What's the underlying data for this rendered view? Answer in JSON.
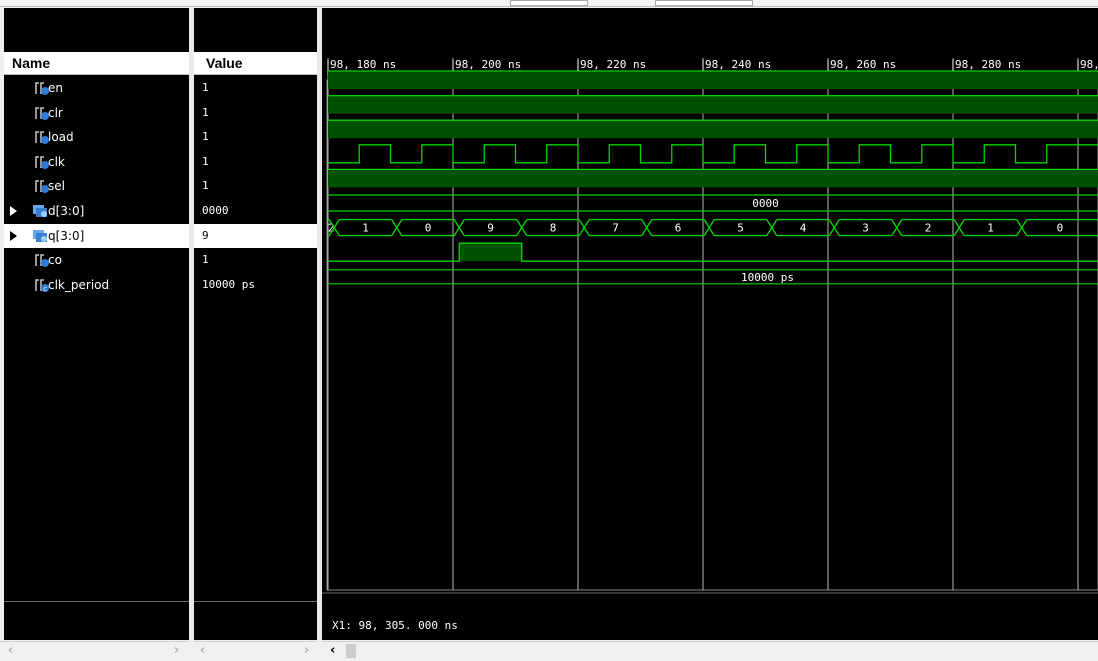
{
  "columns": {
    "name_header": "Name",
    "value_header": "Value"
  },
  "signals": [
    {
      "name": "en",
      "value": "1",
      "icon": "logic-scalar-icon",
      "expandable": false,
      "selected": false
    },
    {
      "name": "clr",
      "value": "1",
      "icon": "logic-scalar-icon",
      "expandable": false,
      "selected": false
    },
    {
      "name": "load",
      "value": "1",
      "icon": "logic-scalar-icon",
      "expandable": false,
      "selected": false
    },
    {
      "name": "clk",
      "value": "1",
      "icon": "logic-scalar-icon",
      "expandable": false,
      "selected": false
    },
    {
      "name": "sel",
      "value": "1",
      "icon": "logic-scalar-icon",
      "expandable": false,
      "selected": false
    },
    {
      "name": "d[3:0]",
      "value": "0000",
      "icon": "logic-vector-icon",
      "expandable": true,
      "selected": false
    },
    {
      "name": "q[3:0]",
      "value": "9",
      "icon": "logic-vector-icon",
      "expandable": true,
      "selected": true
    },
    {
      "name": "co",
      "value": "1",
      "icon": "logic-scalar-icon",
      "expandable": false,
      "selected": false
    },
    {
      "name": "clk_period",
      "value": "10000 ps",
      "icon": "constant-icon",
      "expandable": false,
      "selected": false
    }
  ],
  "timeline": {
    "tick_labels": [
      "98, 180 ns",
      "98, 200 ns",
      "98, 220 ns",
      "98, 240 ns",
      "98, 260 ns",
      "98, 280 ns",
      "98,"
    ]
  },
  "waveforms": {
    "clk_initial": 0,
    "clk_edges_ns": [
      98185,
      98190,
      98195,
      98200,
      98205,
      98210,
      98215,
      98220,
      98225,
      98230,
      98235,
      98240,
      98245,
      98250,
      98255,
      98260,
      98265,
      98270,
      98275,
      98280,
      98285,
      98290,
      98295
    ],
    "d_label": "0000",
    "q_values": [
      "2",
      "1",
      "0",
      "9",
      "8",
      "7",
      "6",
      "5",
      "4",
      "3",
      "2",
      "1",
      "0"
    ],
    "q_transitions_ns": [
      98181,
      98191,
      98201,
      98211,
      98221,
      98231,
      98241,
      98251,
      98261,
      98271,
      98281,
      98291
    ],
    "co_high_ns": [
      98201,
      98211
    ],
    "clk_period_label": "10000 ps"
  },
  "cursor": {
    "label": "X1: 98, 305. 000 ns"
  },
  "colors": {
    "wave_green": "#00d400",
    "bus_fill": "#005e00",
    "high_fill": "#005200",
    "grid": "#b8b8b8"
  }
}
